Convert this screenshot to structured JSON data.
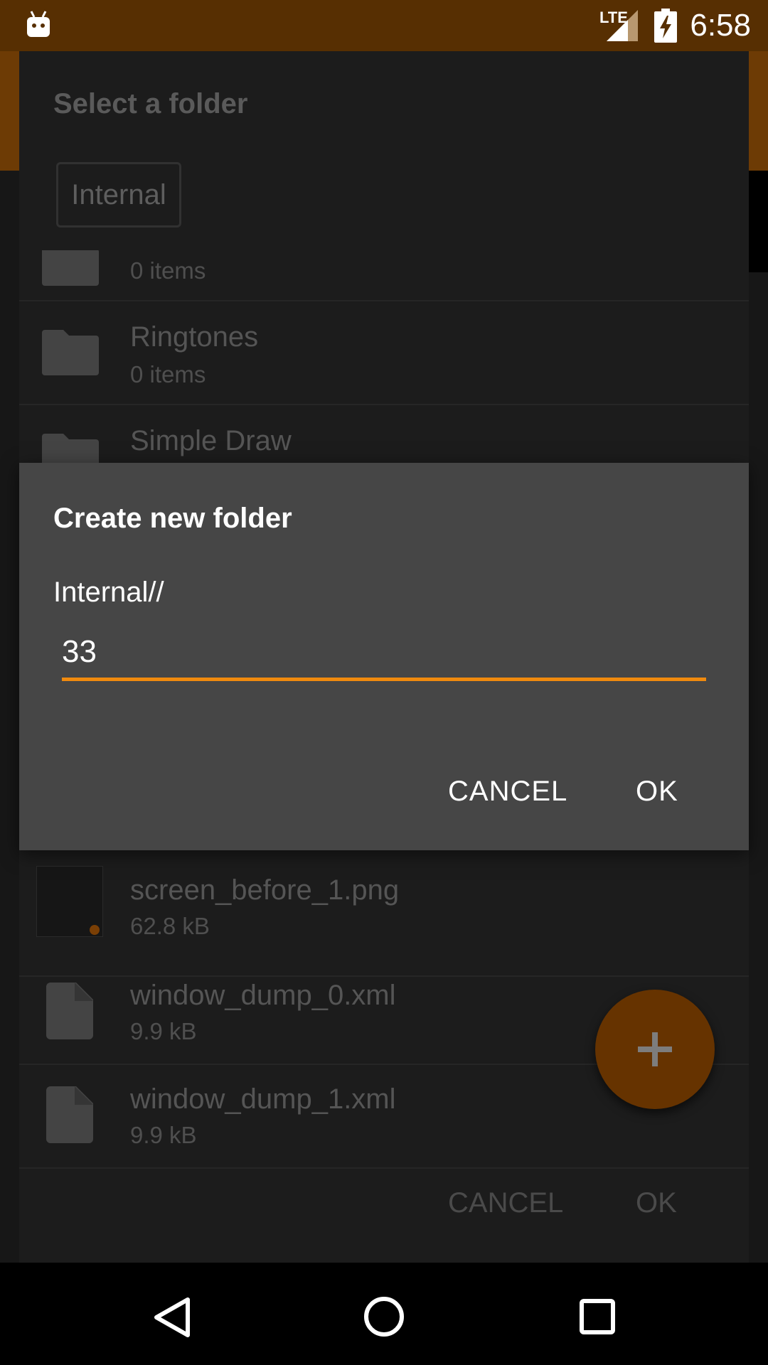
{
  "status_bar": {
    "time": "6:58",
    "network": "LTE",
    "icons": [
      "android-debug-icon",
      "lte-signal-icon",
      "battery-charging-icon"
    ]
  },
  "folder_picker": {
    "title": "Select a folder",
    "storage_chip": "Internal",
    "items": [
      {
        "name": "",
        "detail": "0 items",
        "icon": "folder-icon"
      },
      {
        "name": "Ringtones",
        "detail": "0 items",
        "icon": "folder-icon"
      },
      {
        "name": "Simple Draw",
        "detail": "",
        "icon": "folder-icon"
      },
      {
        "name": "screen_before_1.png",
        "detail": "62.8 kB",
        "icon": "image-thumbnail"
      },
      {
        "name": "window_dump_0.xml",
        "detail": "9.9 kB",
        "icon": "file-icon"
      },
      {
        "name": "window_dump_1.xml",
        "detail": "9.9 kB",
        "icon": "file-icon"
      }
    ],
    "cancel_label": "CANCEL",
    "ok_label": "OK",
    "fab_icon": "plus-icon"
  },
  "create_dialog": {
    "title": "Create new folder",
    "path": "Internal//",
    "input_value": "33",
    "cancel_label": "CANCEL",
    "ok_label": "OK"
  },
  "nav_bar": {
    "icons": [
      "back-icon",
      "home-icon",
      "recents-icon"
    ]
  },
  "colors": {
    "accent": "#f08a0e",
    "status_bar": "#572f02",
    "dialog_bg": "#464646",
    "fab_dimmed": "#663300"
  }
}
